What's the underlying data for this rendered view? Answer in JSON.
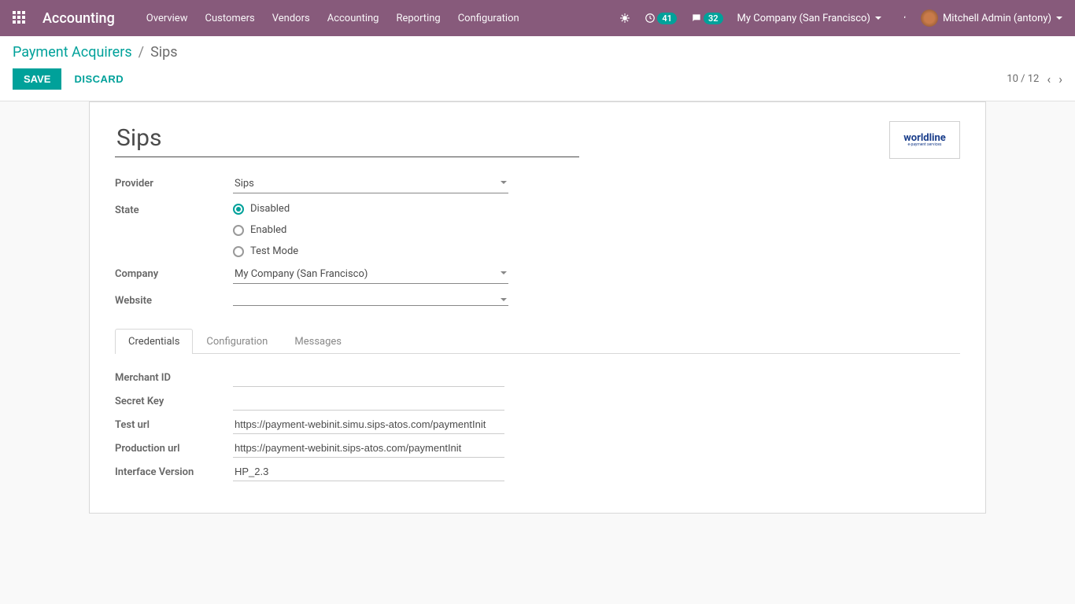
{
  "topbar": {
    "brand": "Accounting",
    "menu": [
      "Overview",
      "Customers",
      "Vendors",
      "Accounting",
      "Reporting",
      "Configuration"
    ],
    "badges": {
      "activity": "41",
      "messages": "32"
    },
    "company": "My Company (San Francisco)",
    "user": "Mitchell Admin (antony)"
  },
  "breadcrumb": {
    "parent": "Payment Acquirers",
    "current": "Sips"
  },
  "actions": {
    "save": "SAVE",
    "discard": "DISCARD"
  },
  "pager": {
    "text": "10 / 12"
  },
  "form": {
    "title": "Sips",
    "logo_text": "worldline",
    "logo_sub": "e-payment services",
    "provider_label": "Provider",
    "provider_value": "Sips",
    "state_label": "State",
    "state": {
      "options": [
        "Disabled",
        "Enabled",
        "Test Mode"
      ],
      "selected": "Disabled"
    },
    "company_label": "Company",
    "company_value": "My Company (San Francisco)",
    "website_label": "Website",
    "website_value": ""
  },
  "tabs": [
    "Credentials",
    "Configuration",
    "Messages"
  ],
  "credentials": {
    "merchant_id_label": "Merchant ID",
    "merchant_id": "",
    "secret_key_label": "Secret Key",
    "secret_key": "",
    "test_url_label": "Test url",
    "test_url": "https://payment-webinit.simu.sips-atos.com/paymentInit",
    "prod_url_label": "Production url",
    "prod_url": "https://payment-webinit.sips-atos.com/paymentInit",
    "interface_version_label": "Interface Version",
    "interface_version": "HP_2.3"
  }
}
